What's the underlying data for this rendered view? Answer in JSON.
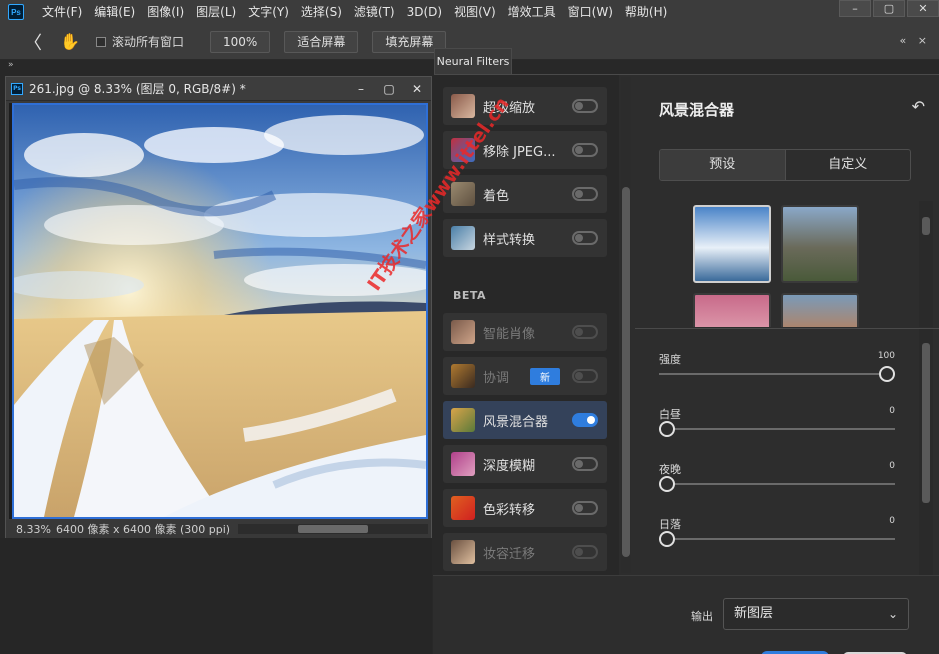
{
  "menubar": {
    "app_icon": "ps-app-icon",
    "app_icon_text": "Ps",
    "items": [
      "文件(F)",
      "编辑(E)",
      "图像(I)",
      "图层(L)",
      "文字(Y)",
      "选择(S)",
      "滤镜(T)",
      "3D(D)",
      "视图(V)",
      "增效工具",
      "窗口(W)",
      "帮助(H)"
    ],
    "window_controls": {
      "minimize": "–",
      "maximize": "▢",
      "close": "✕"
    }
  },
  "optionsbar": {
    "back_icon": "chevron-left-icon",
    "back_glyph": "〈",
    "hand_icon": "hand-tool-icon",
    "hand_glyph": "✋",
    "scroll_all_label": "滚动所有窗口",
    "zoom_value": "100%",
    "fit_screen_label": "适合屏幕",
    "fill_screen_label": "填充屏幕",
    "collapse_glyph": "« ×"
  },
  "left_gutter": {
    "expand_glyph": "»"
  },
  "document": {
    "icon_text": "Ps",
    "title": "261.jpg @ 8.33% (图层 0, RGB/8#) *",
    "controls": {
      "minimize": "–",
      "maximize": "▢",
      "close": "✕"
    },
    "status_zoom": "8.33%",
    "status_info": "6400 像素 x 6400 像素 (300 ppi)",
    "status_arrow": "›"
  },
  "neural_filters": {
    "tab_label": "Neural Filters",
    "beta_label": "BETA",
    "filters": [
      {
        "label": "超级缩放",
        "state": "off",
        "thumb_colors": [
          "#8a5a4a",
          "#d9b8a0"
        ]
      },
      {
        "label": "移除 JPEG...",
        "state": "off",
        "thumb_colors": [
          "#c23040",
          "#3a6ec0"
        ]
      },
      {
        "label": "着色",
        "state": "off",
        "thumb_colors": [
          "#9a8a70",
          "#5e5040"
        ]
      },
      {
        "label": "样式转换",
        "state": "off",
        "thumb_colors": [
          "#4a7fa8",
          "#c8d6e0"
        ]
      },
      {
        "label": "智能肖像",
        "state": "dim",
        "thumb_colors": [
          "#7a5a4a",
          "#cfa58a"
        ]
      },
      {
        "label": "协调",
        "state": "dim",
        "badge": "新",
        "thumb_colors": [
          "#b07a30",
          "#3a2a20"
        ]
      },
      {
        "label": "风景混合器",
        "state": "on",
        "thumb_colors": [
          "#d9a44a",
          "#5a7a3a"
        ]
      },
      {
        "label": "深度模糊",
        "state": "off",
        "thumb_colors": [
          "#b0408a",
          "#e0a0c0"
        ]
      },
      {
        "label": "色彩转移",
        "state": "off",
        "thumb_colors": [
          "#e06020",
          "#d02020"
        ]
      },
      {
        "label": "妆容迁移",
        "state": "dim",
        "thumb_colors": [
          "#6a5040",
          "#e0c0a0"
        ]
      }
    ],
    "settings": {
      "title": "风景混合器",
      "reset_icon": "reset-icon",
      "reset_glyph": "↶",
      "tabs": [
        "预设",
        "自定义"
      ],
      "selected_tab": "预设",
      "presets": [
        {
          "name": "snowy-mountain-lake-preset",
          "colors": [
            "#4a84c8",
            "#e8f0f8",
            "#3a6a9a"
          ],
          "selected": true
        },
        {
          "name": "mountain-valley-preset",
          "colors": [
            "#8aa8c8",
            "#6a6a5a",
            "#4a5a3a"
          ],
          "selected": false
        },
        {
          "name": "sunset-peak-preset",
          "colors": [
            "#c86a8a",
            "#e0a0b0",
            "#4a2a3a"
          ],
          "selected": false
        },
        {
          "name": "canyon-preset",
          "colors": [
            "#7a9ab8",
            "#b8805a",
            "#6a3a2a"
          ],
          "selected": false
        }
      ],
      "sliders": [
        {
          "label": "强度",
          "value": "100",
          "level": 1.0
        },
        {
          "label": "白昼",
          "value": "0",
          "level": 0.0
        },
        {
          "label": "夜晚",
          "value": "0",
          "level": 0.0
        },
        {
          "label": "日落",
          "value": "0",
          "level": 0.0
        }
      ]
    },
    "footer": {
      "output_label": "输出",
      "output_value": "新图层",
      "output_chevron": "⌄"
    }
  },
  "watermark_text": "IT技术之家www.ittel.cn",
  "colors": {
    "accent": "#2f7dde",
    "selection_border": "#2f6fd6",
    "watermark": "#eb2828"
  }
}
